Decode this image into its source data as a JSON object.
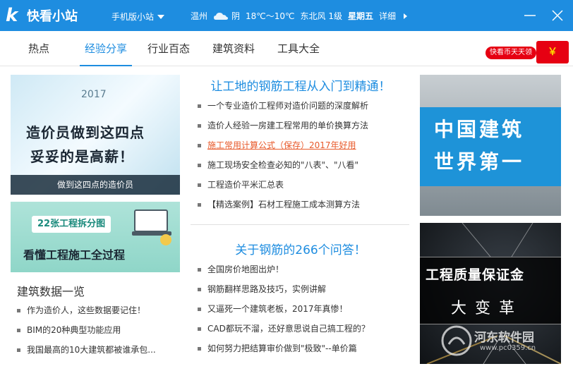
{
  "header": {
    "app_name": "快看小站",
    "mobile_label": "手机版小站",
    "weather": {
      "city": "温州",
      "condition": "阴",
      "temperature": "18℃～10℃",
      "wind": "东北风 1级",
      "weekday": "星期五",
      "detail_label": "详细"
    }
  },
  "nav": {
    "tabs": [
      {
        "label": "热点"
      },
      {
        "label": "经验分享"
      },
      {
        "label": "行业百态"
      },
      {
        "label": "建筑资料"
      },
      {
        "label": "工具大全"
      }
    ],
    "active_index": 1,
    "coin_banner": {
      "label": "快看币天天领",
      "symbol": "￥"
    }
  },
  "left": {
    "banner1": {
      "year": "2017",
      "line1": "造价员做到这四点",
      "line2": "妥妥的是高薪！",
      "caption": "做到这四点的造价员"
    },
    "banner2": {
      "tag": "22张工程拆分图",
      "text": "看懂工程施工全过程"
    },
    "section_title": "建筑数据一览",
    "items": [
      "作为造价人，这些数据要记住！",
      "BIM的20种典型功能应用",
      "我国最高的10大建筑都被谁承包..."
    ]
  },
  "middle": {
    "headline1": "让工地的钢筋工程从入门到精通！",
    "list1": [
      "一个专业造价工程师对造价问题的深度解析",
      "造价人经验一房建工程常用的单价换算方法",
      "施工常用计算公式（保存）2017年好用",
      "施工现场安全检查必知的\"八表\"、\"八看\"",
      "工程造价平米汇总表",
      "【精选案例】石材工程施工成本测算方法"
    ],
    "headline2": "关于钢筋的266个问答！",
    "list2": [
      "全国房价地图出炉！",
      "钢筋翻样思路及技巧，实例讲解",
      "又逼死一个建筑老板，2017年真惨！",
      "CAD都玩不溜，还好意思说自己搞工程的？",
      "如何努力把结算审价做到\"极致\"--单价篇"
    ]
  },
  "right": {
    "banner3": {
      "line1": "中国建筑",
      "line2": "世界第一"
    },
    "banner4": {
      "line1": "工程质量保证金",
      "line2": "大变革"
    },
    "watermark": {
      "text": "河东软件园",
      "url": "www.pc0359.cn"
    }
  },
  "colors": {
    "primary": "#1e8de0",
    "hot_link": "#e8592a",
    "red": "#e60012"
  }
}
